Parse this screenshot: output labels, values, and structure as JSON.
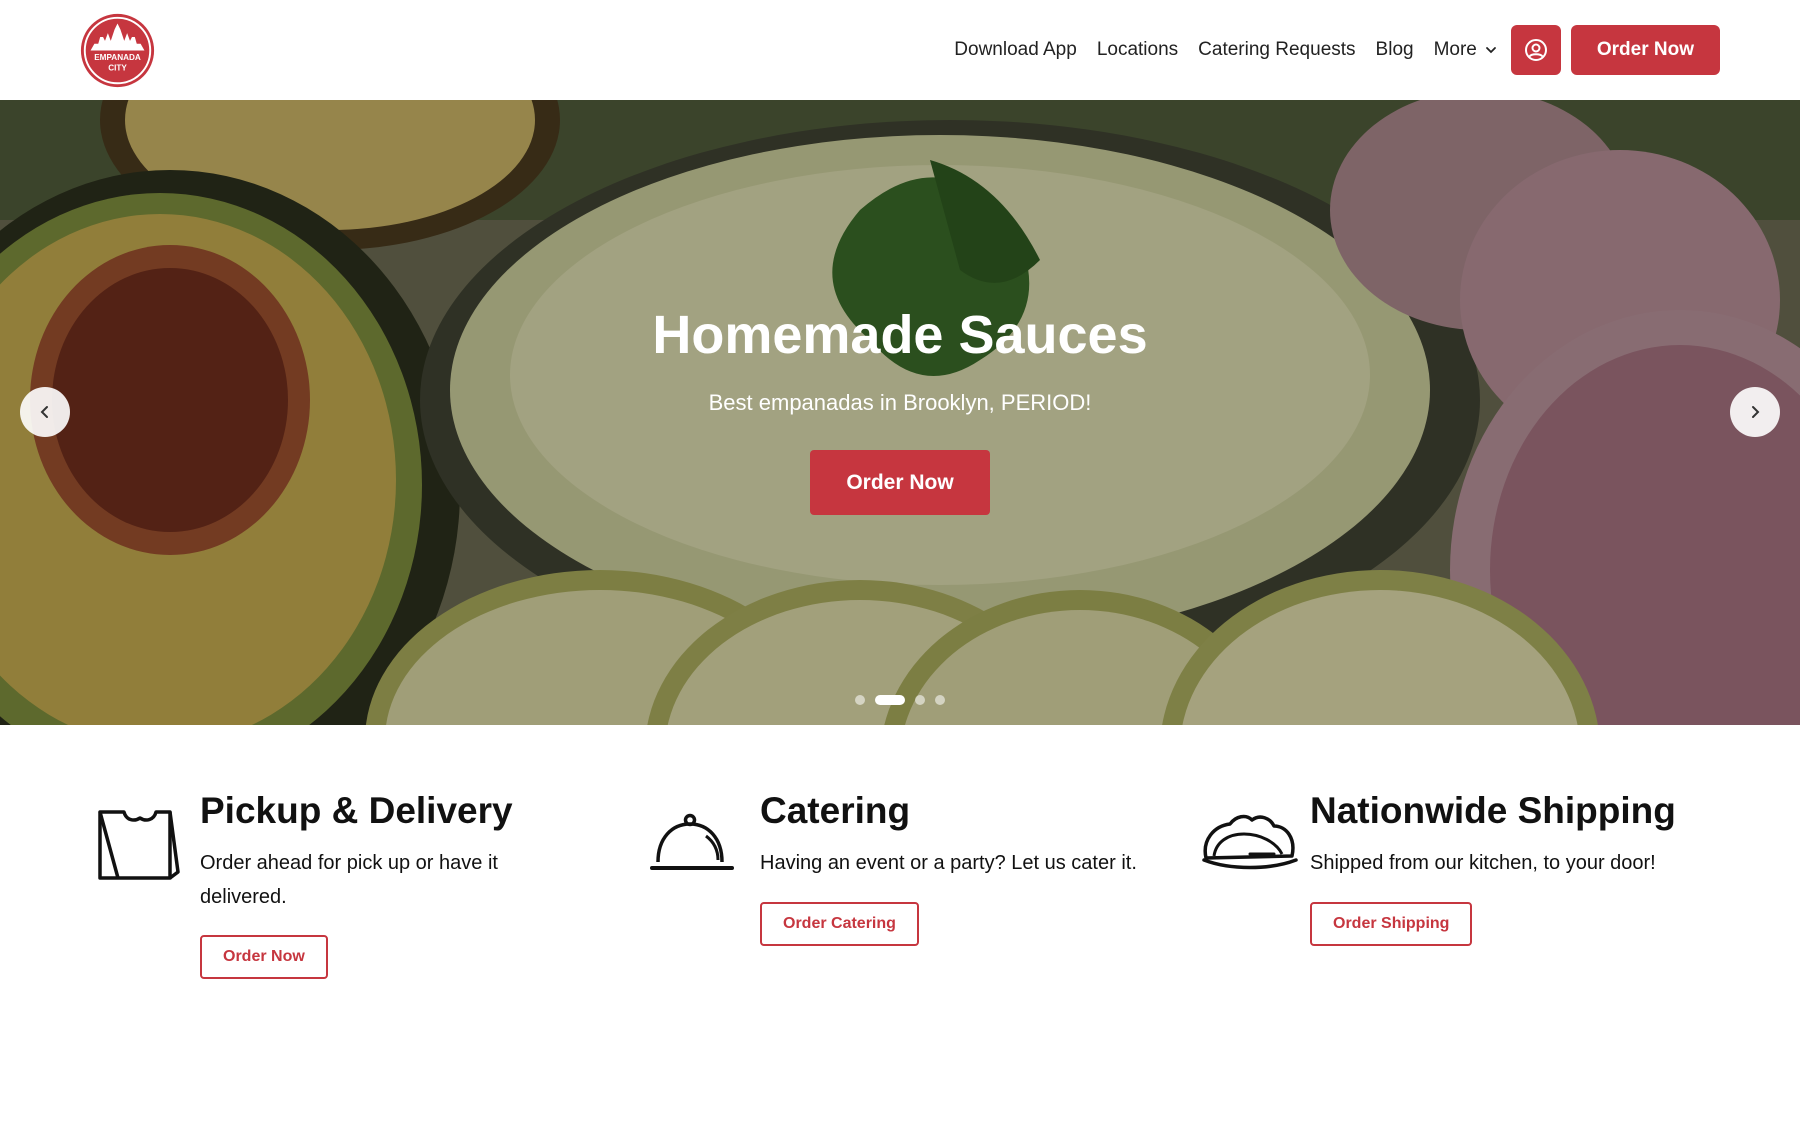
{
  "brand": {
    "accent": "#c6363f"
  },
  "logo": {
    "alt_icon": "empanada-city-logo-icon",
    "line1": "EMPANADA",
    "line2": "CITY"
  },
  "nav": {
    "links": [
      "Download App",
      "Locations",
      "Catering Requests",
      "Blog"
    ],
    "more_label": "More",
    "more_icon": "chevron-down-icon",
    "account_icon": "user-circle-icon",
    "order_label": "Order Now"
  },
  "hero": {
    "title": "Homemade Sauces",
    "subtitle": "Best empanadas in Brooklyn, PERIOD!",
    "cta_label": "Order Now",
    "prev_icon": "chevron-left-icon",
    "next_icon": "chevron-right-icon",
    "slides_count": 4,
    "active_slide": 2
  },
  "features": [
    {
      "icon": "takeout-bag-icon",
      "title": "Pickup & Delivery",
      "description": "Order ahead for pick up or have it delivered.",
      "button": "Order Now"
    },
    {
      "icon": "cloche-icon",
      "title": "Catering",
      "description": "Having an event or a party? Let us cater it.",
      "button": "Order Catering"
    },
    {
      "icon": "empanada-icon",
      "title": "Nationwide Shipping",
      "description": "Shipped from our kitchen, to your door!",
      "button": "Order Shipping"
    }
  ]
}
